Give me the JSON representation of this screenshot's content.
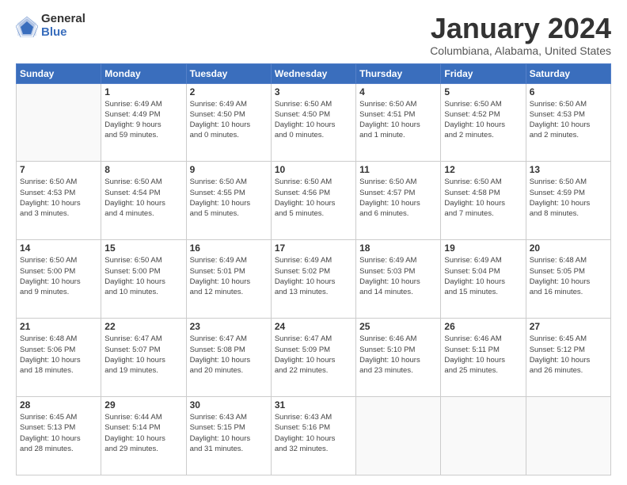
{
  "logo": {
    "general": "General",
    "blue": "Blue"
  },
  "title": {
    "month": "January 2024",
    "location": "Columbiana, Alabama, United States"
  },
  "header_days": [
    "Sunday",
    "Monday",
    "Tuesday",
    "Wednesday",
    "Thursday",
    "Friday",
    "Saturday"
  ],
  "weeks": [
    [
      {
        "day": "",
        "info": ""
      },
      {
        "day": "1",
        "info": "Sunrise: 6:49 AM\nSunset: 4:49 PM\nDaylight: 9 hours\nand 59 minutes."
      },
      {
        "day": "2",
        "info": "Sunrise: 6:49 AM\nSunset: 4:50 PM\nDaylight: 10 hours\nand 0 minutes."
      },
      {
        "day": "3",
        "info": "Sunrise: 6:50 AM\nSunset: 4:50 PM\nDaylight: 10 hours\nand 0 minutes."
      },
      {
        "day": "4",
        "info": "Sunrise: 6:50 AM\nSunset: 4:51 PM\nDaylight: 10 hours\nand 1 minute."
      },
      {
        "day": "5",
        "info": "Sunrise: 6:50 AM\nSunset: 4:52 PM\nDaylight: 10 hours\nand 2 minutes."
      },
      {
        "day": "6",
        "info": "Sunrise: 6:50 AM\nSunset: 4:53 PM\nDaylight: 10 hours\nand 2 minutes."
      }
    ],
    [
      {
        "day": "7",
        "info": "Sunrise: 6:50 AM\nSunset: 4:53 PM\nDaylight: 10 hours\nand 3 minutes."
      },
      {
        "day": "8",
        "info": "Sunrise: 6:50 AM\nSunset: 4:54 PM\nDaylight: 10 hours\nand 4 minutes."
      },
      {
        "day": "9",
        "info": "Sunrise: 6:50 AM\nSunset: 4:55 PM\nDaylight: 10 hours\nand 5 minutes."
      },
      {
        "day": "10",
        "info": "Sunrise: 6:50 AM\nSunset: 4:56 PM\nDaylight: 10 hours\nand 5 minutes."
      },
      {
        "day": "11",
        "info": "Sunrise: 6:50 AM\nSunset: 4:57 PM\nDaylight: 10 hours\nand 6 minutes."
      },
      {
        "day": "12",
        "info": "Sunrise: 6:50 AM\nSunset: 4:58 PM\nDaylight: 10 hours\nand 7 minutes."
      },
      {
        "day": "13",
        "info": "Sunrise: 6:50 AM\nSunset: 4:59 PM\nDaylight: 10 hours\nand 8 minutes."
      }
    ],
    [
      {
        "day": "14",
        "info": "Sunrise: 6:50 AM\nSunset: 5:00 PM\nDaylight: 10 hours\nand 9 minutes."
      },
      {
        "day": "15",
        "info": "Sunrise: 6:50 AM\nSunset: 5:00 PM\nDaylight: 10 hours\nand 10 minutes."
      },
      {
        "day": "16",
        "info": "Sunrise: 6:49 AM\nSunset: 5:01 PM\nDaylight: 10 hours\nand 12 minutes."
      },
      {
        "day": "17",
        "info": "Sunrise: 6:49 AM\nSunset: 5:02 PM\nDaylight: 10 hours\nand 13 minutes."
      },
      {
        "day": "18",
        "info": "Sunrise: 6:49 AM\nSunset: 5:03 PM\nDaylight: 10 hours\nand 14 minutes."
      },
      {
        "day": "19",
        "info": "Sunrise: 6:49 AM\nSunset: 5:04 PM\nDaylight: 10 hours\nand 15 minutes."
      },
      {
        "day": "20",
        "info": "Sunrise: 6:48 AM\nSunset: 5:05 PM\nDaylight: 10 hours\nand 16 minutes."
      }
    ],
    [
      {
        "day": "21",
        "info": "Sunrise: 6:48 AM\nSunset: 5:06 PM\nDaylight: 10 hours\nand 18 minutes."
      },
      {
        "day": "22",
        "info": "Sunrise: 6:47 AM\nSunset: 5:07 PM\nDaylight: 10 hours\nand 19 minutes."
      },
      {
        "day": "23",
        "info": "Sunrise: 6:47 AM\nSunset: 5:08 PM\nDaylight: 10 hours\nand 20 minutes."
      },
      {
        "day": "24",
        "info": "Sunrise: 6:47 AM\nSunset: 5:09 PM\nDaylight: 10 hours\nand 22 minutes."
      },
      {
        "day": "25",
        "info": "Sunrise: 6:46 AM\nSunset: 5:10 PM\nDaylight: 10 hours\nand 23 minutes."
      },
      {
        "day": "26",
        "info": "Sunrise: 6:46 AM\nSunset: 5:11 PM\nDaylight: 10 hours\nand 25 minutes."
      },
      {
        "day": "27",
        "info": "Sunrise: 6:45 AM\nSunset: 5:12 PM\nDaylight: 10 hours\nand 26 minutes."
      }
    ],
    [
      {
        "day": "28",
        "info": "Sunrise: 6:45 AM\nSunset: 5:13 PM\nDaylight: 10 hours\nand 28 minutes."
      },
      {
        "day": "29",
        "info": "Sunrise: 6:44 AM\nSunset: 5:14 PM\nDaylight: 10 hours\nand 29 minutes."
      },
      {
        "day": "30",
        "info": "Sunrise: 6:43 AM\nSunset: 5:15 PM\nDaylight: 10 hours\nand 31 minutes."
      },
      {
        "day": "31",
        "info": "Sunrise: 6:43 AM\nSunset: 5:16 PM\nDaylight: 10 hours\nand 32 minutes."
      },
      {
        "day": "",
        "info": ""
      },
      {
        "day": "",
        "info": ""
      },
      {
        "day": "",
        "info": ""
      }
    ]
  ]
}
